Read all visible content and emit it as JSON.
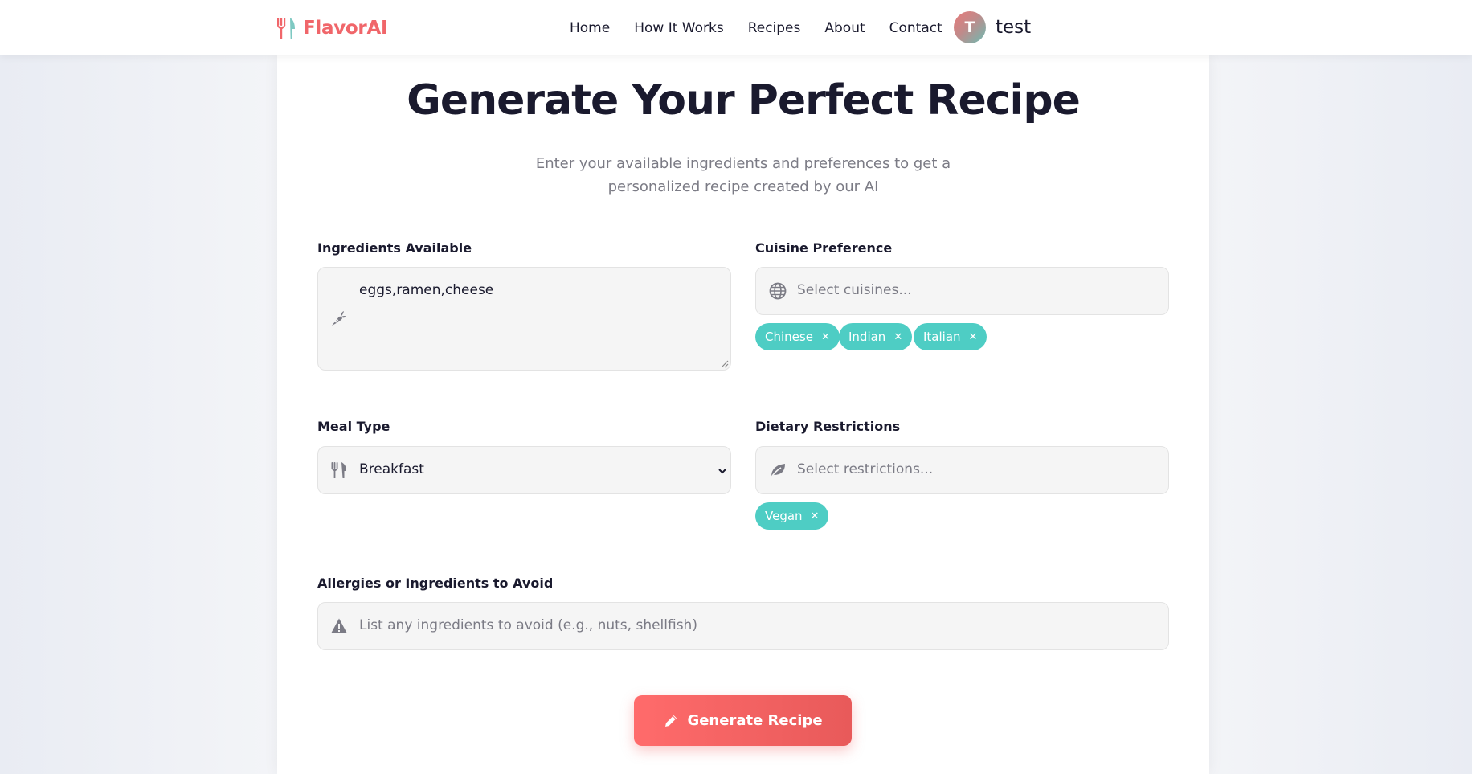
{
  "brand": {
    "name": "FlavorAI",
    "icon": "fork-knife-icon",
    "color": "#f0666a"
  },
  "nav": {
    "links": [
      "Home",
      "How It Works",
      "Recipes",
      "About",
      "Contact"
    ]
  },
  "user": {
    "initial": "T",
    "name": "test"
  },
  "main": {
    "title": "Generate Your Perfect Recipe",
    "subtitle": "Enter your available ingredients and preferences to get a personalized recipe created by our AI"
  },
  "form": {
    "ingredients": {
      "label": "Ingredients Available",
      "value": "eggs,ramen,cheese",
      "icon": "carrot-icon"
    },
    "cuisine": {
      "label": "Cuisine Preference",
      "placeholder": "Select cuisines...",
      "icon": "globe-icon",
      "tags": [
        "Chinese",
        "Indian",
        "Italian"
      ]
    },
    "meal_type": {
      "label": "Meal Type",
      "selected": "Breakfast",
      "icon": "utensils-icon"
    },
    "dietary": {
      "label": "Dietary Restrictions",
      "placeholder": "Select restrictions...",
      "icon": "leaf-icon",
      "tags": [
        "Vegan"
      ]
    },
    "allergies": {
      "label": "Allergies or Ingredients to Avoid",
      "placeholder": "List any ingredients to avoid (e.g., nuts, shellfish)",
      "icon": "warning-icon"
    },
    "submit": {
      "label": "Generate Recipe",
      "icon": "pencil-icon"
    }
  },
  "colors": {
    "accent": "#ff6b6b",
    "tag": "#4ecdc4",
    "text": "#1a1a2e",
    "muted": "#7b7b85"
  }
}
